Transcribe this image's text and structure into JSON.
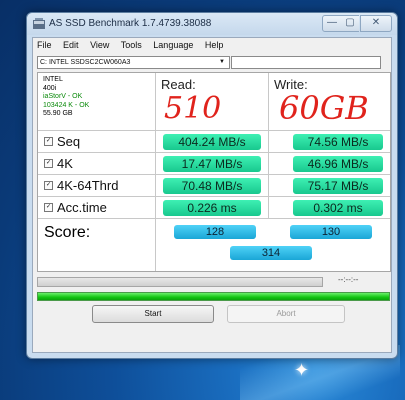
{
  "window": {
    "title": "AS SSD Benchmark 1.7.4739.38088",
    "controls": {
      "min": "—",
      "max": "▢",
      "close": "✕"
    }
  },
  "menu": [
    "File",
    "Edit",
    "View",
    "Tools",
    "Language",
    "Help"
  ],
  "drive": {
    "selected": "C: INTEL SSDSC2CW060A3",
    "path": ""
  },
  "info": {
    "model": "INTEL",
    "firmware": "400i",
    "driver": "iaStorV - OK",
    "alignment": "103424 K - OK",
    "size": "55.90 GB"
  },
  "headers": {
    "read": "Read:",
    "write": "Write:"
  },
  "annotations": {
    "read_note": "510",
    "write_note": "60GB",
    "color": "#e0231c"
  },
  "rows": [
    {
      "label": "Seq",
      "read": "404.24 MB/s",
      "write": "74.56 MB/s"
    },
    {
      "label": "4K",
      "read": "17.47 MB/s",
      "write": "46.96 MB/s"
    },
    {
      "label": "4K-64Thrd",
      "read": "70.48 MB/s",
      "write": "75.17 MB/s"
    },
    {
      "label": "Acc.time",
      "read": "0.226 ms",
      "write": "0.302 ms"
    }
  ],
  "score": {
    "label": "Score:",
    "read": "128",
    "write": "130",
    "total": "314"
  },
  "status": {
    "time": "--:--:--",
    "gray_progress": 0.0,
    "green_progress": 1.0
  },
  "buttons": {
    "start": "Start",
    "abort": "Abort"
  },
  "colors": {
    "result_pill": "#1fd69a",
    "score_pill": "#2bb8e6",
    "progress": "#14c414"
  }
}
